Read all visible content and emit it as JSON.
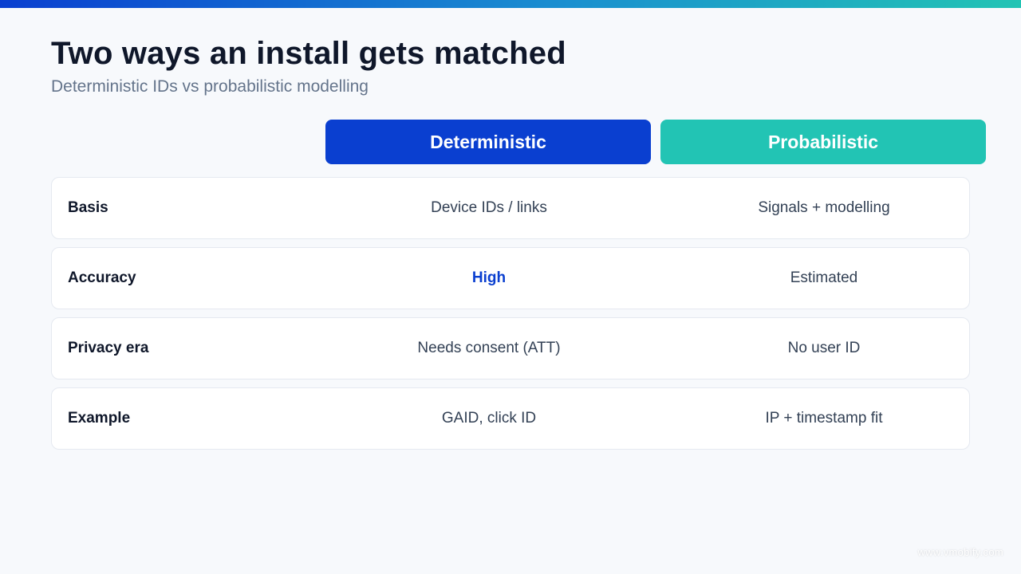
{
  "title": "Two ways an install gets matched",
  "subtitle": "Deterministic IDs vs probabilistic modelling",
  "columns": {
    "deterministic": "Deterministic",
    "probabilistic": "Probabilistic"
  },
  "rows": [
    {
      "label": "Basis",
      "deterministic": "Device IDs / links",
      "probabilistic": "Signals + modelling"
    },
    {
      "label": "Accuracy",
      "deterministic": "High",
      "probabilistic": "Estimated"
    },
    {
      "label": "Privacy era",
      "deterministic": "Needs consent (ATT)",
      "probabilistic": "No user ID"
    },
    {
      "label": "Example",
      "deterministic": "GAID, click ID",
      "probabilistic": "IP + timestamp fit"
    }
  ],
  "watermark": "www.vmobify.com",
  "colors": {
    "deterministic": "#0a3fd0",
    "probabilistic": "#22c4b4",
    "highlight_text": "#0a3fd0"
  }
}
